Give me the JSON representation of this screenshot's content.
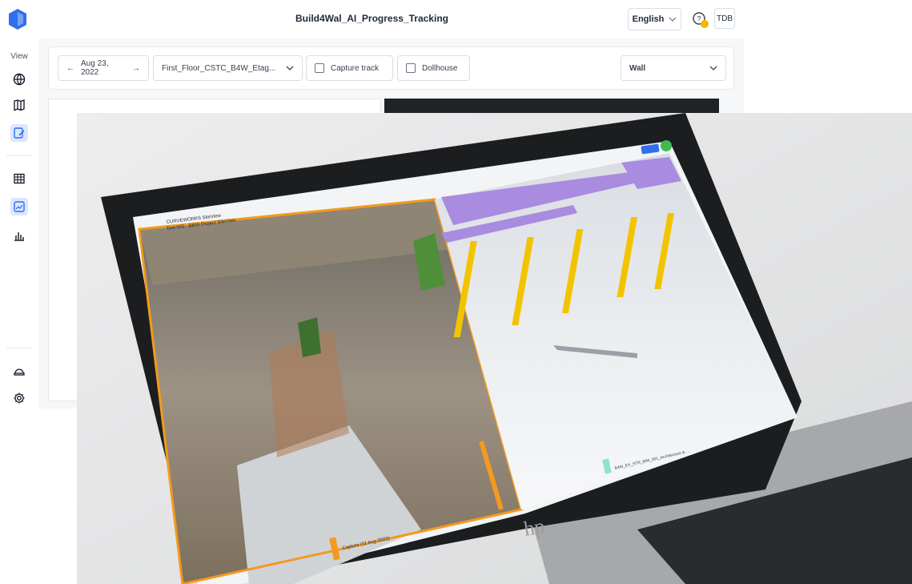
{
  "app": {
    "title": "Build4Wal_AI_Progress_Tracking",
    "language": "English",
    "user_initials": "TDB"
  },
  "sidebar": {
    "view_label": "View",
    "items": [
      {
        "icon": "globe-icon"
      },
      {
        "icon": "map-icon"
      },
      {
        "icon": "progress-icon",
        "active": true
      },
      {
        "icon": "table-icon"
      },
      {
        "icon": "image-compare-icon",
        "active": true
      },
      {
        "icon": "bar-chart-icon"
      },
      {
        "icon": "helmet-icon"
      },
      {
        "icon": "gear-icon"
      }
    ]
  },
  "toolbar": {
    "date": "Aug 23, 2022",
    "floor": "First_Floor_CSTC_B4W_Etag...",
    "capture_track": "Capture track",
    "dollhouse": "Dollhouse",
    "filter": "Wall"
  },
  "photo": {
    "brand": "hp",
    "screen_header_line1": "CURVEWORKS SiteView",
    "screen_header_line2": "Test-WS - BBRI Project SiteView",
    "capture_label": "Capture (11 Aug 2022)",
    "bim_label": "B4W_EX_STR_BIM_001_Architecture & ..."
  },
  "colors": {
    "accent": "#2f6fed",
    "active_bg": "#dbe7ff",
    "orange": "#f39a1e",
    "steel_purple": "#a98be0",
    "column_yellow": "#f2c400"
  }
}
